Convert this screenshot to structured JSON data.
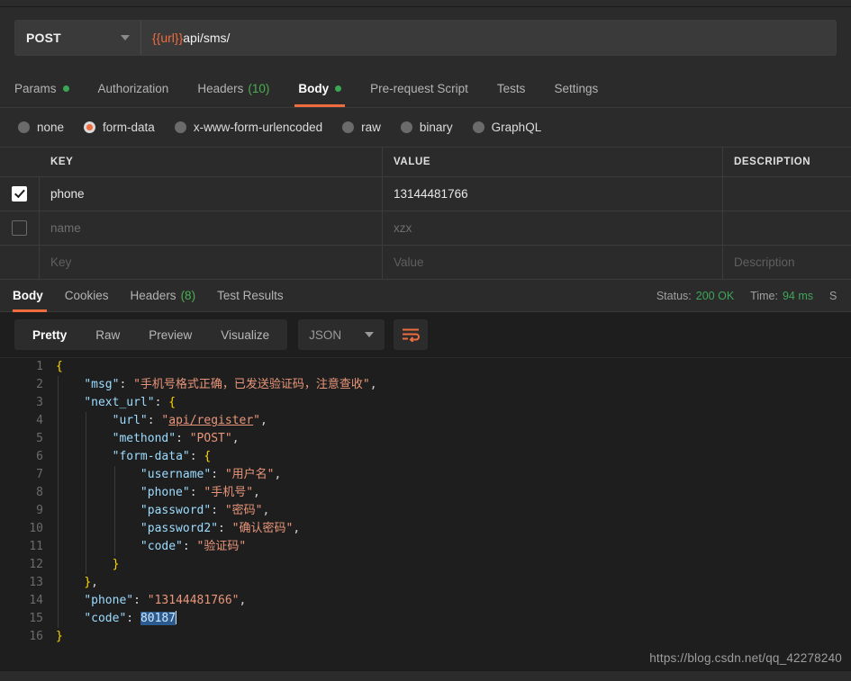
{
  "request": {
    "method": "POST",
    "url_variable": "{{url}}",
    "url_path": "api/sms/",
    "tabs": [
      {
        "label": "Params",
        "badge": "dot",
        "active": false
      },
      {
        "label": "Authorization",
        "badge": "",
        "active": false
      },
      {
        "label": "Headers",
        "badge": "(10)",
        "active": false
      },
      {
        "label": "Body",
        "badge": "dot",
        "active": true
      },
      {
        "label": "Pre-request Script",
        "badge": "",
        "active": false
      },
      {
        "label": "Tests",
        "badge": "",
        "active": false
      },
      {
        "label": "Settings",
        "badge": "",
        "active": false
      }
    ],
    "body_types": [
      {
        "label": "none",
        "selected": false
      },
      {
        "label": "form-data",
        "selected": true
      },
      {
        "label": "x-www-form-urlencoded",
        "selected": false
      },
      {
        "label": "raw",
        "selected": false
      },
      {
        "label": "binary",
        "selected": false
      },
      {
        "label": "GraphQL",
        "selected": false
      }
    ],
    "table": {
      "headers": {
        "key": "KEY",
        "value": "VALUE",
        "description": "DESCRIPTION"
      },
      "rows": [
        {
          "checked": true,
          "placeholder": false,
          "key": "phone",
          "value": "13144481766",
          "description": ""
        },
        {
          "checked": false,
          "placeholder": false,
          "key": "name",
          "value": "xzx",
          "description": ""
        },
        {
          "checked": false,
          "placeholder": true,
          "key": "Key",
          "value": "Value",
          "description": "Description"
        }
      ]
    }
  },
  "response": {
    "tabs": [
      {
        "label": "Body",
        "badge": "",
        "active": true
      },
      {
        "label": "Cookies",
        "badge": "",
        "active": false
      },
      {
        "label": "Headers",
        "badge": "(8)",
        "active": false
      },
      {
        "label": "Test Results",
        "badge": "",
        "active": false
      }
    ],
    "status_label": "Status:",
    "status_value": "200 OK",
    "time_label": "Time:",
    "time_value": "94 ms",
    "size_label_clipped": "S",
    "view_modes": [
      {
        "label": "Pretty",
        "active": true
      },
      {
        "label": "Raw",
        "active": false
      },
      {
        "label": "Preview",
        "active": false
      },
      {
        "label": "Visualize",
        "active": false
      }
    ],
    "format": "JSON",
    "wrap_icon": "word-wrap-icon",
    "code_lines": [
      {
        "n": "1",
        "indent": 0,
        "html": "<span class=\"tok-brace\">{</span>"
      },
      {
        "n": "2",
        "indent": 1,
        "html": "<span class=\"tok-key\">\"msg\"</span><span class=\"tok-punct\">: </span><span class=\"tok-str\">\"手机号格式正确，已发送验证码，注意查收\"</span><span class=\"tok-punct\">,</span>"
      },
      {
        "n": "3",
        "indent": 1,
        "html": "<span class=\"tok-key\">\"next_url\"</span><span class=\"tok-punct\">: </span><span class=\"tok-brace\">{</span>"
      },
      {
        "n": "4",
        "indent": 2,
        "html": "<span class=\"tok-key\">\"url\"</span><span class=\"tok-punct\">: </span><span class=\"tok-str\">\"</span><span class=\"tok-url\">api/register</span><span class=\"tok-str\">\"</span><span class=\"tok-punct\">,</span>"
      },
      {
        "n": "5",
        "indent": 2,
        "html": "<span class=\"tok-key\">\"methond\"</span><span class=\"tok-punct\">: </span><span class=\"tok-str\">\"POST\"</span><span class=\"tok-punct\">,</span>"
      },
      {
        "n": "6",
        "indent": 2,
        "html": "<span class=\"tok-key\">\"form-data\"</span><span class=\"tok-punct\">: </span><span class=\"tok-brace\">{</span>"
      },
      {
        "n": "7",
        "indent": 3,
        "html": "<span class=\"tok-key\">\"username\"</span><span class=\"tok-punct\">: </span><span class=\"tok-str\">\"用户名\"</span><span class=\"tok-punct\">,</span>"
      },
      {
        "n": "8",
        "indent": 3,
        "html": "<span class=\"tok-key\">\"phone\"</span><span class=\"tok-punct\">: </span><span class=\"tok-str\">\"手机号\"</span><span class=\"tok-punct\">,</span>"
      },
      {
        "n": "9",
        "indent": 3,
        "html": "<span class=\"tok-key\">\"password\"</span><span class=\"tok-punct\">: </span><span class=\"tok-str\">\"密码\"</span><span class=\"tok-punct\">,</span>"
      },
      {
        "n": "10",
        "indent": 3,
        "html": "<span class=\"tok-key\">\"password2\"</span><span class=\"tok-punct\">: </span><span class=\"tok-str\">\"确认密码\"</span><span class=\"tok-punct\">,</span>"
      },
      {
        "n": "11",
        "indent": 3,
        "html": "<span class=\"tok-key\">\"code\"</span><span class=\"tok-punct\">: </span><span class=\"tok-str\">\"验证码\"</span>"
      },
      {
        "n": "12",
        "indent": 2,
        "html": "<span class=\"tok-brace\">}</span>"
      },
      {
        "n": "13",
        "indent": 1,
        "html": "<span class=\"tok-brace\">}</span><span class=\"tok-punct\">,</span>"
      },
      {
        "n": "14",
        "indent": 1,
        "html": "<span class=\"tok-key\">\"phone\"</span><span class=\"tok-punct\">: </span><span class=\"tok-str\">\"13144481766\"</span><span class=\"tok-punct\">,</span>"
      },
      {
        "n": "15",
        "indent": 1,
        "html": "<span class=\"tok-key\">\"code\"</span><span class=\"tok-punct\">: </span><span class=\"tok-sel\">80187</span><span class=\"caret-bar\"></span>"
      },
      {
        "n": "16",
        "indent": 0,
        "html": "<span class=\"tok-brace\">}</span>"
      }
    ],
    "selected_text": "80187"
  },
  "watermark": "https://blog.csdn.net/qq_42278240"
}
